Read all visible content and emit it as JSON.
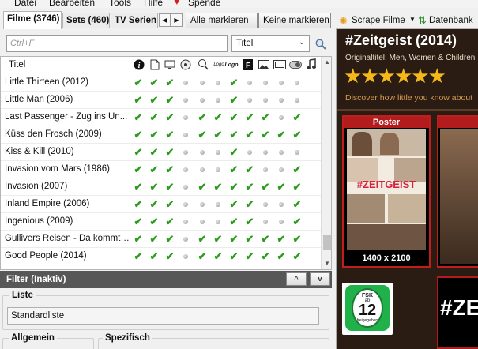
{
  "menu": [
    "Datei",
    "Bearbeiten",
    "Tools",
    "Hilfe",
    "Spende"
  ],
  "tabs": [
    {
      "label": "Filme (3746)",
      "active": true
    },
    {
      "label": "Sets (460)",
      "active": false
    },
    {
      "label": "TV Serien (",
      "active": false
    }
  ],
  "toolbar": {
    "mark_all": "Alle markieren",
    "mark_none": "Keine markieren",
    "scrape": "Scrape Filme",
    "database": "Datenbank"
  },
  "search": {
    "placeholder": "Ctrl+F",
    "field": "Titel"
  },
  "table": {
    "title_header": "Titel",
    "columns": [
      "info-icon",
      "nfo-icon",
      "monitor-icon",
      "disc-icon",
      "search-logo-icon",
      "logo-icon",
      "f-icon",
      "image-icon",
      "landscape-icon",
      "toggle-icon",
      "music-icon"
    ],
    "rows": [
      {
        "title": "Little Thirteen (2012)",
        "flags": [
          1,
          1,
          1,
          0,
          0,
          0,
          1,
          0,
          0,
          0,
          0
        ]
      },
      {
        "title": "Little Man (2006)",
        "flags": [
          1,
          1,
          1,
          0,
          0,
          0,
          1,
          0,
          0,
          0,
          0
        ]
      },
      {
        "title": "Last Passenger - Zug ins Un...",
        "flags": [
          1,
          1,
          1,
          0,
          1,
          1,
          1,
          1,
          1,
          0,
          1
        ]
      },
      {
        "title": "Küss den Frosch (2009)",
        "flags": [
          1,
          1,
          1,
          0,
          1,
          1,
          1,
          1,
          1,
          1,
          1
        ]
      },
      {
        "title": "Kiss & Kill (2010)",
        "flags": [
          1,
          1,
          1,
          0,
          0,
          0,
          1,
          0,
          0,
          0,
          0
        ]
      },
      {
        "title": "Invasion vom Mars (1986)",
        "flags": [
          1,
          1,
          1,
          0,
          0,
          0,
          1,
          1,
          0,
          0,
          1
        ]
      },
      {
        "title": "Invasion (2007)",
        "flags": [
          1,
          1,
          1,
          0,
          1,
          1,
          1,
          1,
          1,
          1,
          1
        ]
      },
      {
        "title": "Inland Empire (2006)",
        "flags": [
          1,
          1,
          1,
          0,
          0,
          0,
          1,
          1,
          0,
          0,
          1
        ]
      },
      {
        "title": "Ingenious (2009)",
        "flags": [
          1,
          1,
          1,
          0,
          0,
          0,
          1,
          1,
          0,
          0,
          1
        ]
      },
      {
        "title": "Gullivers Reisen - Da kommt ...",
        "flags": [
          1,
          1,
          1,
          0,
          1,
          1,
          1,
          1,
          1,
          1,
          1
        ]
      },
      {
        "title": "Good People (2014)",
        "flags": [
          1,
          1,
          1,
          0,
          1,
          1,
          1,
          1,
          1,
          1,
          1
        ]
      }
    ]
  },
  "filter": {
    "title": "Filter (Inaktiv)",
    "list_label": "Liste",
    "list_value": "Standardliste",
    "general_label": "Allgemein",
    "specific_label": "Spezifisch"
  },
  "movie": {
    "title": "#Zeitgeist (2014)",
    "original": "Originaltitel: Men, Women & Children",
    "stars": 6,
    "tagline": "Discover how little you know about",
    "poster_label": "Poster",
    "poster_size": "1400 x 2100",
    "poster_text": "#ZEITGEIST",
    "fanart_text": "#ZE",
    "fsk_top": "FSK",
    "fsk_sub": "ab",
    "fsk_age": "12",
    "fsk_bottom": "freigegeben"
  },
  "colors": {
    "check": "#2d9b1e",
    "panel_bg": "#2a1c12",
    "accent_red": "#b21c1c",
    "fsk_green": "#20b14a"
  }
}
